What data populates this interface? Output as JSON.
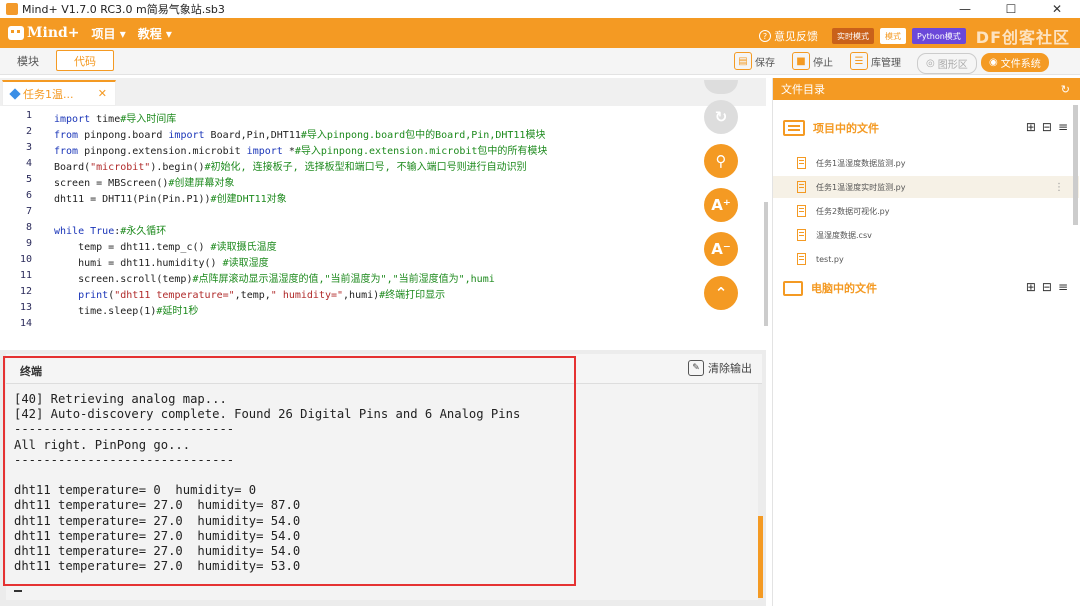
{
  "window": {
    "title": "Mind+ V1.7.0 RC3.0   m简易气象站.sb3"
  },
  "menubar": {
    "logo": "Mind+",
    "menu_project": "项目 ▾",
    "menu_tutorial": "教程 ▾",
    "feedback": "意见反馈",
    "mode_realtime": "实时模式",
    "mode_upload": "模式",
    "mode_python": "Python模式",
    "watermark": "DF创客社区"
  },
  "toolbar": {
    "tab_blocks": "模块",
    "tab_code": "代码",
    "save": "保存",
    "stop": "停止",
    "library": "库管理",
    "graph": "图形区",
    "filesystem": "文件系统"
  },
  "editor": {
    "tab_label": "任务1温...",
    "line_numbers": [
      "1",
      "2",
      "3",
      "4",
      "5",
      "6",
      "7",
      "8",
      "9",
      "10",
      "11",
      "12",
      "13",
      "14"
    ]
  },
  "terminal": {
    "title": "终端",
    "clear_label": "清除输出",
    "lines": [
      "[40] Retrieving analog map...",
      "[42] Auto-discovery complete. Found 26 Digital Pins and 6 Analog Pins",
      "------------------------------",
      "All right. PinPong go...",
      "------------------------------",
      "",
      "dht11 temperature= 0  humidity= 0",
      "dht11 temperature= 27.0  humidity= 87.0",
      "dht11 temperature= 27.0  humidity= 54.0",
      "dht11 temperature= 27.0  humidity= 54.0",
      "dht11 temperature= 27.0  humidity= 54.0",
      "dht11 temperature= 27.0  humidity= 53.0"
    ]
  },
  "files": {
    "header": "文件目录",
    "project_section": "项目中的文件",
    "computer_section": "电脑中的文件",
    "items": [
      "任务1温湿度数据监测.py",
      "任务1温湿度实时监测.py",
      "任务2数据可视化.py",
      "温湿度数据.csv",
      "test.py"
    ]
  },
  "colors": {
    "accent": "#f49a23",
    "highlight": "#e53232"
  }
}
